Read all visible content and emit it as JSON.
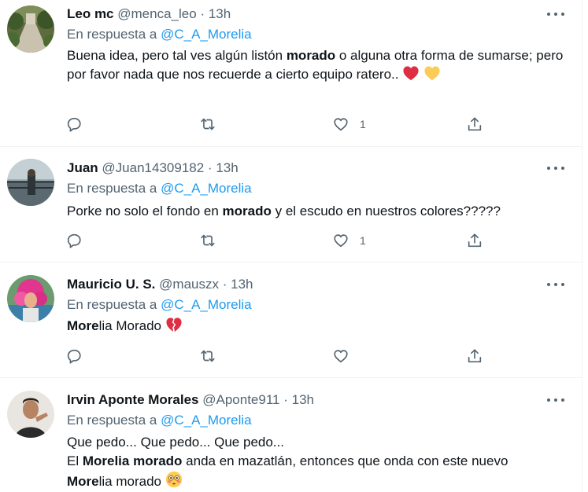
{
  "reply_prefix": "En respuesta a",
  "tweets": [
    {
      "name": "Leo mc",
      "handle": "@menca_leo",
      "time": "13h",
      "mention": "@C_A_Morelia",
      "text": [
        {
          "t": "Buena idea, pero tal ves algún listón ",
          "b": false
        },
        {
          "t": "morado",
          "b": true
        },
        {
          "t": " o alguna otra forma de sumarse; pero por favor nada que nos recuerde a cierto equipo ratero.. ",
          "b": false
        }
      ],
      "emojis": [
        "red-heart",
        "yellow-heart"
      ],
      "likes": "1",
      "avatar": "garden-path"
    },
    {
      "name": "Juan",
      "handle": "@Juan14309182",
      "time": "13h",
      "mention": "@C_A_Morelia",
      "text": [
        {
          "t": "Porke no solo el fondo en ",
          "b": false
        },
        {
          "t": "morado",
          "b": true
        },
        {
          "t": " y el escudo en nuestros colores?????",
          "b": false
        }
      ],
      "emojis": [],
      "likes": "1",
      "avatar": "person-bridge"
    },
    {
      "name": "Mauricio U. S.",
      "handle": "@mauszx",
      "time": "13h",
      "mention": "@C_A_Morelia",
      "text": [
        {
          "t": "More",
          "b": true
        },
        {
          "t": "lia Morado ",
          "b": false
        }
      ],
      "emojis": [
        "broken-heart"
      ],
      "likes": "",
      "avatar": "pink-wig"
    },
    {
      "name": "Irvin Aponte Morales",
      "handle": "@Aponte911",
      "time": "13h",
      "mention": "@C_A_Morelia",
      "text": [
        {
          "t": "Que pedo... Que pedo... Que pedo...",
          "b": false
        },
        {
          "br": true
        },
        {
          "t": "El ",
          "b": false
        },
        {
          "t": "Morelia morado",
          "b": true
        },
        {
          "t": " anda en mazatlán, entonces que onda con este nuevo ",
          "b": false
        },
        {
          "br": true
        },
        {
          "t": "More",
          "b": true
        },
        {
          "t": "lia morado ",
          "b": false
        }
      ],
      "emojis": [
        "flushed-face"
      ],
      "likes": "",
      "avatar": "person-portrait"
    }
  ],
  "colors": {
    "secondary_text": "#536471",
    "link": "#1d9bf0",
    "divider": "#eff3f4"
  }
}
